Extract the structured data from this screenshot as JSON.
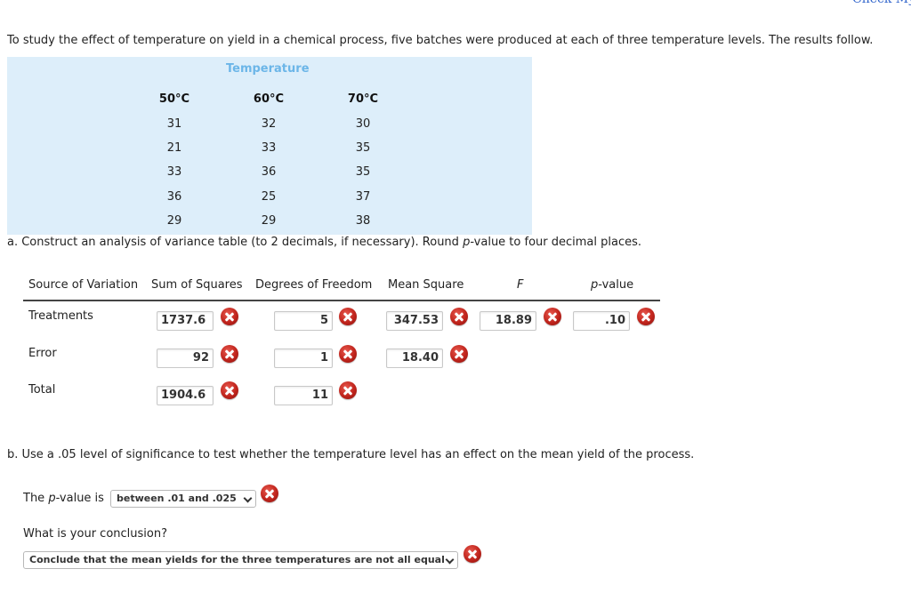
{
  "header": {
    "check_link": "Check My"
  },
  "intro": "To study the effect of temperature on yield in a chemical process, five batches were produced at each of three temperature levels. The results follow.",
  "data_table": {
    "title": "Temperature",
    "columns": [
      "50°C",
      "60°C",
      "70°C"
    ],
    "rows": [
      [
        "31",
        "32",
        "30"
      ],
      [
        "21",
        "33",
        "35"
      ],
      [
        "33",
        "36",
        "35"
      ],
      [
        "36",
        "25",
        "37"
      ],
      [
        "29",
        "29",
        "38"
      ]
    ]
  },
  "part_a": {
    "prompt_pre": "a. Construct an analysis of variance table (to 2 decimals, if necessary). Round ",
    "prompt_italic": "p",
    "prompt_post": "-value to four decimal places.",
    "headers": {
      "source": "Source of Variation",
      "ss": "Sum of Squares",
      "df": "Degrees of Freedom",
      "ms": "Mean Square",
      "f": "F",
      "p_italic": "p",
      "p_rest": "-value"
    },
    "rows": [
      {
        "label": "Treatments",
        "ss": "1737.6",
        "df": "5",
        "ms": "347.53",
        "f": "18.89",
        "p": ".10"
      },
      {
        "label": "Error",
        "ss": "92",
        "df": "1",
        "ms": "18.40"
      },
      {
        "label": "Total",
        "ss": "1904.6",
        "df": "11"
      }
    ],
    "status_icon": "incorrect-x-icon"
  },
  "part_b": {
    "prompt": "b. Use a .05 level of significance to test whether the temperature level has an effect on the mean yield of the process.",
    "pvalue_label_pre": "The ",
    "pvalue_label_italic": "p",
    "pvalue_label_post": "-value is",
    "pvalue_selected": "between .01 and .025",
    "conclusion_label": "What is your conclusion?",
    "conclusion_selected": "Conclude that the mean yields for the three temperatures are not all equal"
  }
}
